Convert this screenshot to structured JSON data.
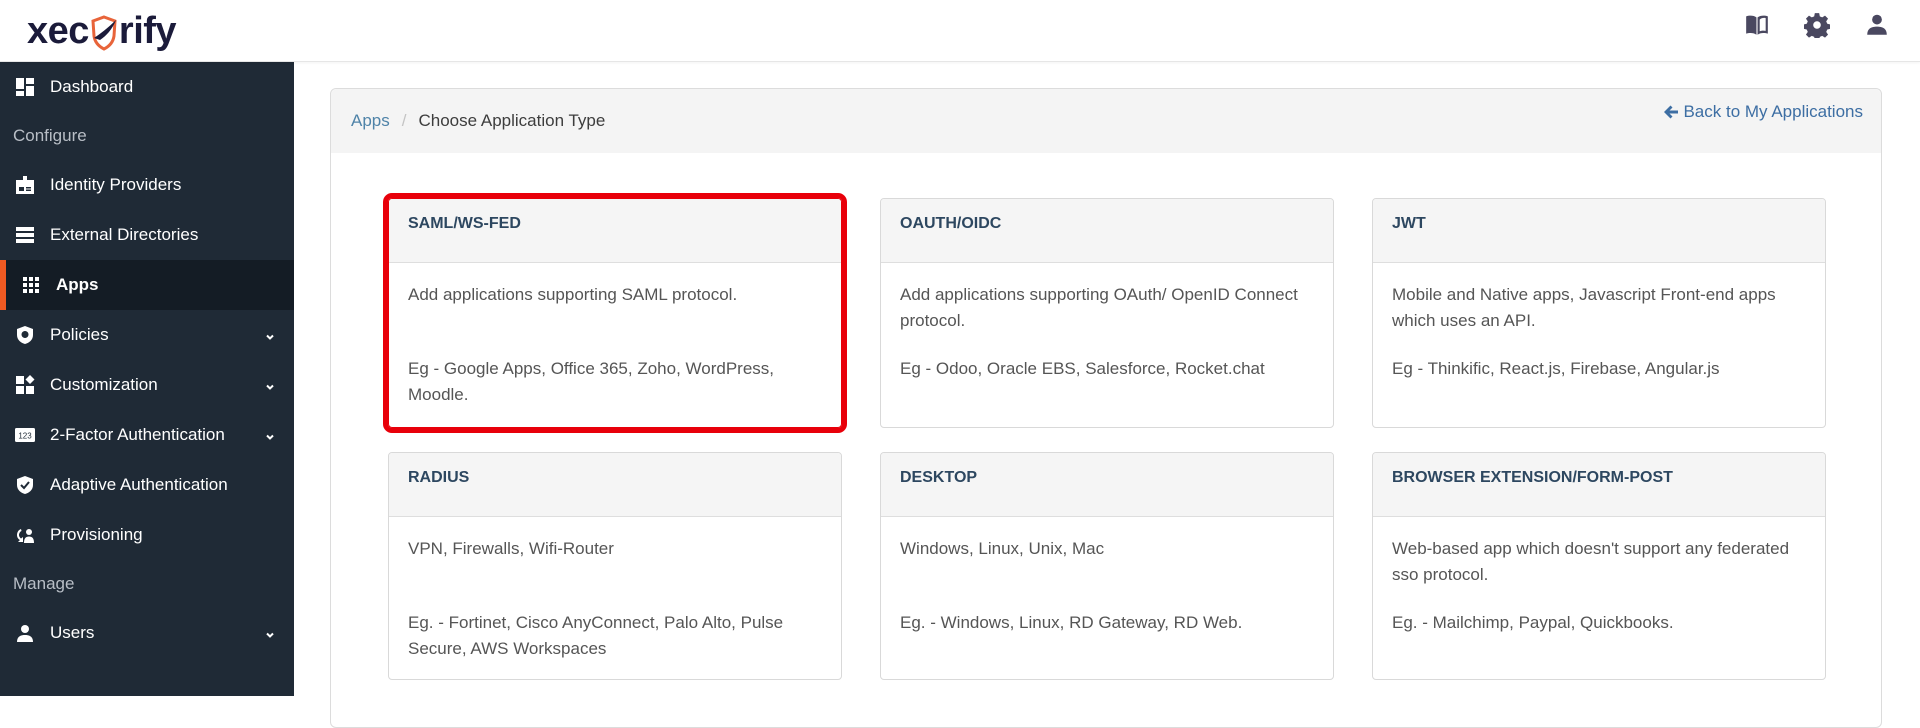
{
  "header": {
    "logo_text_before": "xec",
    "logo_text_after": "rify",
    "brand_colors": {
      "dark": "#1b1b3a",
      "accent": "#e8643a"
    },
    "icons": [
      "book-icon",
      "gear-icon",
      "user-icon"
    ]
  },
  "sidebar": {
    "items": [
      {
        "type": "item",
        "label": "Dashboard",
        "icon": "dashboard-icon",
        "expandable": false,
        "active": false
      },
      {
        "type": "section",
        "label": "Configure"
      },
      {
        "type": "item",
        "label": "Identity Providers",
        "icon": "id-badge-icon",
        "expandable": false,
        "active": false
      },
      {
        "type": "item",
        "label": "External Directories",
        "icon": "server-icon",
        "expandable": false,
        "active": false
      },
      {
        "type": "item",
        "label": "Apps",
        "icon": "grid-icon",
        "expandable": false,
        "active": true
      },
      {
        "type": "item",
        "label": "Policies",
        "icon": "shield-search-icon",
        "expandable": true,
        "active": false
      },
      {
        "type": "item",
        "label": "Customization",
        "icon": "customize-icon",
        "expandable": true,
        "active": false
      },
      {
        "type": "item",
        "label": "2-Factor Authentication",
        "icon": "numbers-123-icon",
        "expandable": true,
        "active": false
      },
      {
        "type": "item",
        "label": "Adaptive Authentication",
        "icon": "shield-check-icon",
        "expandable": false,
        "active": false
      },
      {
        "type": "item",
        "label": "Provisioning",
        "icon": "user-sync-icon",
        "expandable": false,
        "active": false
      },
      {
        "type": "section",
        "label": "Manage"
      },
      {
        "type": "item",
        "label": "Users",
        "icon": "user-icon",
        "expandable": true,
        "active": false
      }
    ],
    "active_accent": "#f05a22"
  },
  "breadcrumb": {
    "parent": "Apps",
    "separator": "/",
    "current": "Choose Application Type"
  },
  "back_link": {
    "label": "Back to My Applications",
    "icon": "arrow-left-icon"
  },
  "cards": [
    {
      "title": "SAML/WS-FED",
      "description": "Add applications supporting SAML protocol.",
      "examples": "Eg - Google Apps, Office 365, Zoho, WordPress, Moodle.",
      "highlighted": true
    },
    {
      "title": "OAUTH/OIDC",
      "description": "Add applications supporting OAuth/ OpenID Connect protocol.",
      "examples": "Eg - Odoo, Oracle EBS, Salesforce, Rocket.chat",
      "highlighted": false
    },
    {
      "title": "JWT",
      "description": "Mobile and Native apps, Javascript Front-end apps which uses an API.",
      "examples": "Eg - Thinkific, React.js, Firebase, Angular.js",
      "highlighted": false
    },
    {
      "title": "RADIUS",
      "description": "VPN, Firewalls, Wifi-Router",
      "examples": "Eg. - Fortinet, Cisco AnyConnect, Palo Alto, Pulse Secure, AWS Workspaces",
      "highlighted": false
    },
    {
      "title": "DESKTOP",
      "description": "Windows, Linux, Unix, Mac",
      "examples": "Eg. - Windows, Linux, RD Gateway, RD Web.",
      "highlighted": false
    },
    {
      "title": "BROWSER EXTENSION/FORM-POST",
      "description": "Web-based app which doesn't support any federated sso protocol.",
      "examples": "Eg. - Mailchimp, Paypal, Quickbooks.",
      "highlighted": false
    }
  ],
  "highlight_color": "#e8000a"
}
